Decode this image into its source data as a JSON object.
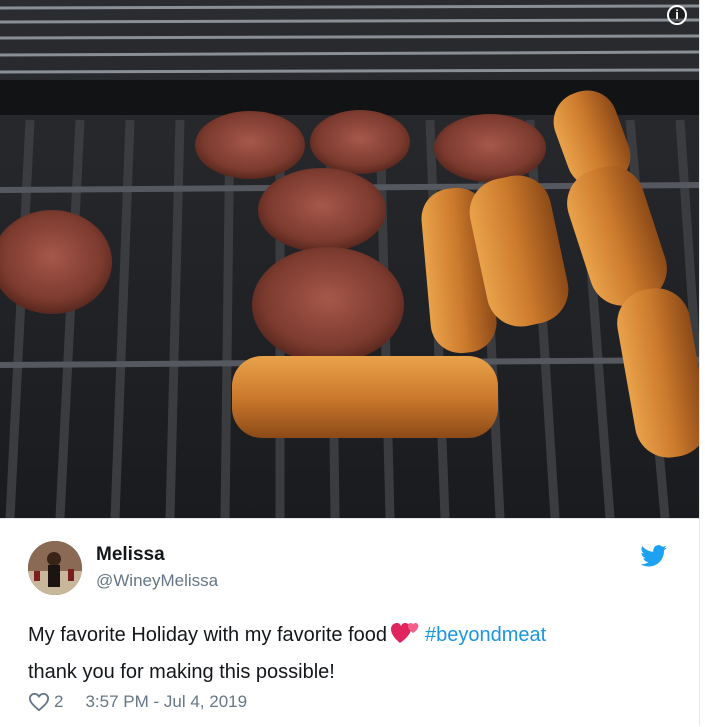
{
  "media": {
    "info_icon": "info-icon",
    "info_glyph": "i",
    "alt": ""
  },
  "user": {
    "name": "Melissa",
    "handle": "@WineyMelissa",
    "avatar_icon": "avatar"
  },
  "tweet": {
    "text_before": "My favorite Holiday with my favorite food",
    "emoji_icon": "two-hearts-icon",
    "hashtag": "#beyondmeat",
    "text_after": "thank you for making this possible!",
    "like_count": "2",
    "timestamp": "3:57 PM - Jul 4, 2019"
  },
  "colors": {
    "hashtag": "#1b95e0",
    "twitter_blue": "#1da1f2",
    "secondary_text": "#657786",
    "primary_text": "#14171a"
  }
}
